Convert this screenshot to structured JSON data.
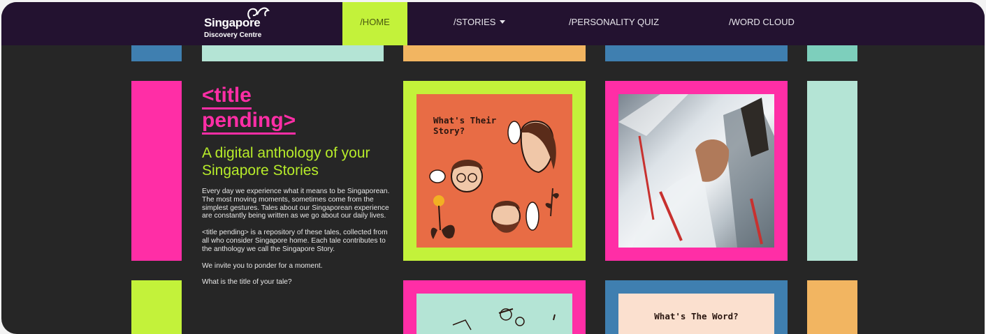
{
  "brand": {
    "name": "Singapore",
    "subtitle": "Discovery Centre"
  },
  "nav": {
    "items": [
      {
        "label": "/HOME",
        "active": true
      },
      {
        "label": "/STORIES",
        "dropdown": true
      },
      {
        "label": "/PERSONALITY QUIZ"
      },
      {
        "label": "/WORD CLOUD"
      }
    ],
    "dropdown_icon": "caret-down-icon"
  },
  "hero": {
    "title_line1": "<title",
    "title_line2": "pending>",
    "subtitle": "A digital anthology of your Singapore Stories",
    "paragraphs": [
      "Every day we experience what it means to be Singaporean. The most moving moments, sometimes come from the simplest gestures. Tales about our Singaporean experience are constantly being written as we go about our daily lives.",
      "<title pending> is a repository of these tales, collected from all who consider Singapore home. Each tale contributes to the anthology we call the Singapore Story.",
      "We invite you to ponder for a moment.",
      "What is the title of your tale?"
    ]
  },
  "cards": {
    "story_card_text": "What's Their Story?",
    "word_card_text": "What's The Word?"
  },
  "colors": {
    "nav_bg": "#231230",
    "page_bg": "#262626",
    "lime": "#c3f23a",
    "pink": "#ff2ea6",
    "mint": "#b4e4d5",
    "orange": "#f2b561",
    "blue": "#3f7fb0",
    "coral": "#e86c45"
  }
}
